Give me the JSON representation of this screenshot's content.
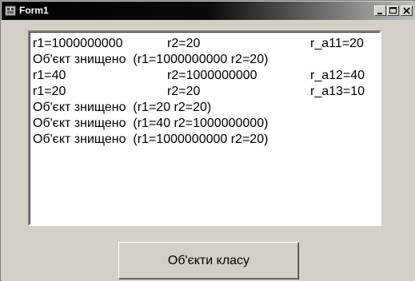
{
  "window": {
    "title": "Form1",
    "icon": "app-icon",
    "controls": {
      "minimize_icon": "minimize-icon",
      "maximize_icon": "maximize-icon",
      "close_icon": "close-icon"
    }
  },
  "memo": {
    "lines": [
      {
        "c1": "r1=1000000000",
        "c2": "r2=20",
        "c3": "r_a11=20"
      },
      {
        "c1": "Об'єкт знищено  (r1=1000000000 r2=20)",
        "c2": "",
        "c3": ""
      },
      {
        "c1": "r1=40",
        "c2": "r2=1000000000",
        "c3": "r_a12=40"
      },
      {
        "c1": "r1=20",
        "c2": "r2=20",
        "c3": "r_a13=10"
      },
      {
        "c1": "Об'єкт знищено  (r1=20 r2=20)",
        "c2": "",
        "c3": ""
      },
      {
        "c1": "Об'єкт знищено  (r1=40 r2=1000000000)",
        "c2": "",
        "c3": ""
      },
      {
        "c1": "Об'єкт знищено  (r1=1000000000 r2=20)",
        "c2": "",
        "c3": ""
      }
    ]
  },
  "button": {
    "label": "Об'єкти класу"
  },
  "colors": {
    "face": "#d4d0c8",
    "memo_bg": "#ffffff",
    "titlebar_start": "#000000",
    "titlebar_end": "#bdbdbd"
  }
}
